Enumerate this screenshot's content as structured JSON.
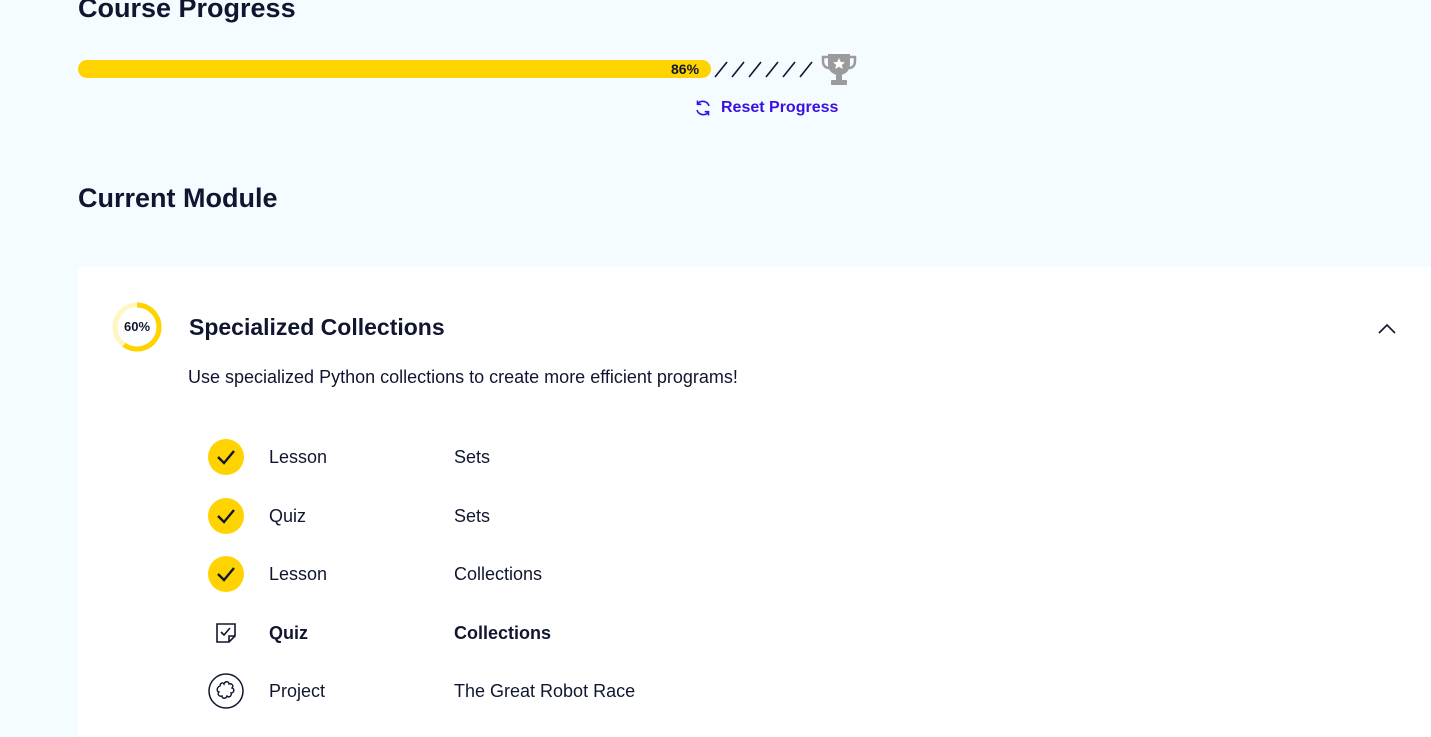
{
  "course_progress": {
    "title": "Course Progress",
    "percent_label": "86%",
    "percent_value": 86,
    "reset_label": "Reset Progress"
  },
  "current_module": {
    "section_title": "Current Module",
    "progress_label": "60%",
    "progress_value": 60,
    "title": "Specialized Collections",
    "description": "Use specialized Python collections to create more efficient programs!",
    "items": [
      {
        "kind": "Lesson",
        "name": "Sets",
        "status": "complete",
        "icon": "check-icon"
      },
      {
        "kind": "Quiz",
        "name": "Sets",
        "status": "complete",
        "icon": "check-icon"
      },
      {
        "kind": "Lesson",
        "name": "Collections",
        "status": "complete",
        "icon": "check-icon"
      },
      {
        "kind": "Quiz",
        "name": "Collections",
        "status": "current",
        "icon": "quiz-icon"
      },
      {
        "kind": "Project",
        "name": "The Great Robot Race",
        "status": "not-started",
        "icon": "project-icon"
      }
    ]
  },
  "colors": {
    "accent_yellow": "#ffd300",
    "link_blue": "#3a10e5",
    "text_navy": "#10162f",
    "page_bg": "#f5fcff",
    "trophy_gray": "#9b9b9b"
  }
}
